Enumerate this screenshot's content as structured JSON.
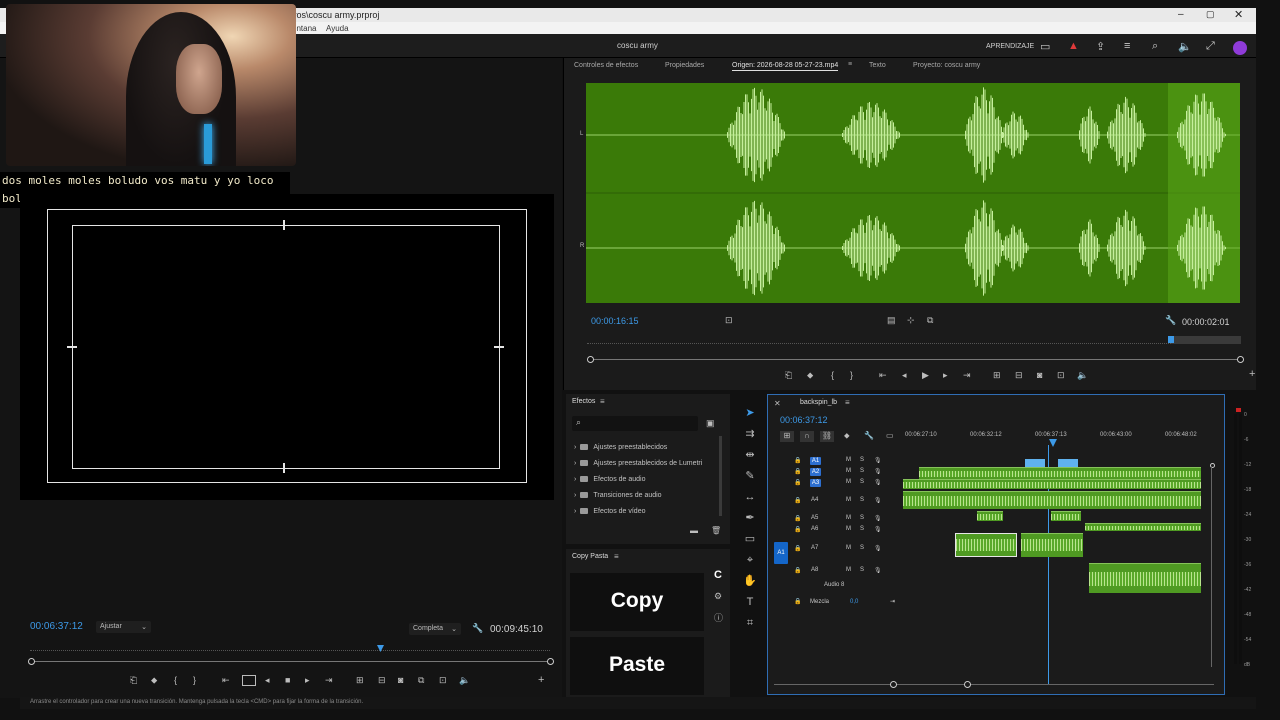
{
  "window": {
    "title": "vos\\coscu army.prproj",
    "menu": [
      "entana",
      "Ayuda"
    ],
    "project_name": "coscu army",
    "learning_label": "APRENDIZAJE"
  },
  "webcam": {
    "caption_lines": [
      "dos moles moles boludo vos matu y yo loco",
      "boludo aguante si"
    ]
  },
  "program_monitor": {
    "current_timecode": "00:06:37:12",
    "fit_label": "Ajustar",
    "quality_label": "Completa",
    "duration": "00:09:45:10"
  },
  "source_panel": {
    "tabs": [
      "Controles de efectos",
      "Propiedades",
      "Origen: 2026-08-28 05-27-23.mp4",
      "Texto",
      "Proyecto: coscu army"
    ],
    "channel_labels": [
      "L",
      "L",
      "R",
      "R"
    ],
    "current_timecode": "00:00:16:15",
    "duration": "00:00:02:01"
  },
  "effects_panel": {
    "title": "Efectos",
    "search_placeholder": "",
    "items": [
      "Ajustes preestablecidos",
      "Ajustes preestablecidos de Lumetri",
      "Efectos de audio",
      "Transiciones de audio",
      "Efectos de vídeo"
    ]
  },
  "copy_paste_panel": {
    "title": "Copy Pasta",
    "copy_label": "Copy",
    "paste_label": "Paste",
    "side_letter": "C"
  },
  "timeline": {
    "sequence_name": "backspin_lb",
    "current_timecode": "00:06:37:12",
    "ruler": [
      "00:06:27:10",
      "00:06:32:12",
      "00:06:37:13",
      "00:06:43:00",
      "00:06:48:02"
    ],
    "tracks": [
      {
        "name": "A1",
        "m": "M",
        "s": "S"
      },
      {
        "name": "A2",
        "m": "M",
        "s": "S"
      },
      {
        "name": "A3",
        "m": "M",
        "s": "S"
      },
      {
        "name": "A4",
        "m": "M",
        "s": "S"
      },
      {
        "name": "A5",
        "m": "M",
        "s": "S"
      },
      {
        "name": "A6",
        "m": "M",
        "s": "S"
      },
      {
        "name": "A7",
        "m": "M",
        "s": "S"
      },
      {
        "name": "A8",
        "m": "M",
        "s": "S"
      }
    ],
    "source_target": "A1",
    "a8_label": "Audio 8",
    "mix_label": "Mezcla",
    "mix_value": "0,0"
  },
  "meters": {
    "ticks": [
      "0",
      "-6",
      "-12",
      "-18",
      "-24",
      "-30",
      "-36",
      "-42",
      "-48",
      "-54",
      "dB"
    ]
  },
  "status_bar": {
    "text": "Arrastre el controlador para crear una nueva transición. Mantenga pulsada la tecla <CMD> para fijar la forma de la transición."
  },
  "colors": {
    "accent": "#3d9ae8",
    "waveform_bg": "#3a7a08",
    "waveform_fg": "#c6ef9d",
    "clip": "#4f9a22",
    "panel_bg": "#1b1b1b"
  }
}
